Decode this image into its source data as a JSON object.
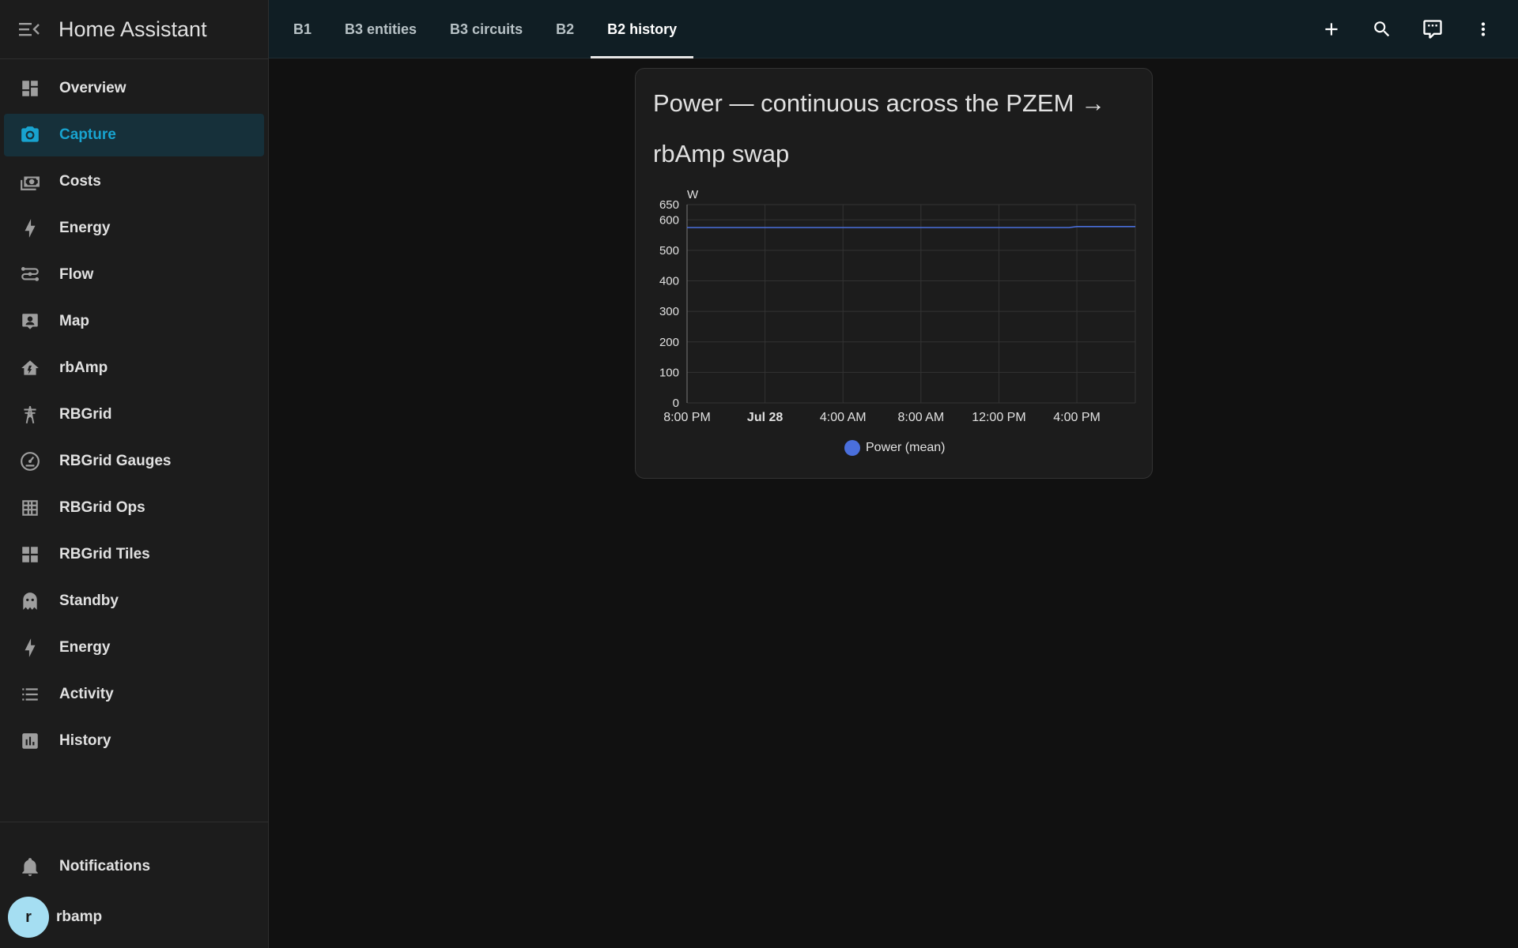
{
  "app": {
    "title": "Home Assistant"
  },
  "sidebar": {
    "items": [
      {
        "label": "Overview",
        "icon": "dashboard-icon"
      },
      {
        "label": "Capture",
        "icon": "camera-icon",
        "selected": true
      },
      {
        "label": "Costs",
        "icon": "cash-icon"
      },
      {
        "label": "Energy",
        "icon": "lightning-icon"
      },
      {
        "label": "Flow",
        "icon": "flow-icon"
      },
      {
        "label": "Map",
        "icon": "account-box-icon"
      },
      {
        "label": "rbAmp",
        "icon": "home-lightning-icon"
      },
      {
        "label": "RBGrid",
        "icon": "transmission-tower-icon"
      },
      {
        "label": "RBGrid Gauges",
        "icon": "gauge-icon"
      },
      {
        "label": "RBGrid Ops",
        "icon": "grid-icon"
      },
      {
        "label": "RBGrid Tiles",
        "icon": "view-grid-icon"
      },
      {
        "label": "Standby",
        "icon": "ghost-icon"
      },
      {
        "label": "Energy",
        "icon": "lightning-icon"
      },
      {
        "label": "Activity",
        "icon": "format-list-icon"
      },
      {
        "label": "History",
        "icon": "chart-box-icon"
      }
    ],
    "notifications_label": "Notifications",
    "user": {
      "name": "rbamp",
      "initial": "r"
    }
  },
  "topbar": {
    "tabs": [
      {
        "label": "B1"
      },
      {
        "label": "B3 entities"
      },
      {
        "label": "B3 circuits"
      },
      {
        "label": "B2"
      },
      {
        "label": "B2 history",
        "active": true
      }
    ],
    "actions": [
      "plus-icon",
      "search-icon",
      "comment-icon",
      "dots-vertical-icon"
    ]
  },
  "card": {
    "title": "Power — continuous across the PZEM → rbAmp swap"
  },
  "chart_data": {
    "type": "line",
    "unit": "W",
    "y_ticks": [
      0,
      100,
      200,
      300,
      400,
      500,
      600,
      650
    ],
    "ylim": [
      0,
      650
    ],
    "x_ticks": [
      {
        "label": "8:00 PM",
        "bold": false
      },
      {
        "label": "Jul 28",
        "bold": true
      },
      {
        "label": "4:00 AM",
        "bold": false
      },
      {
        "label": "8:00 AM",
        "bold": false
      },
      {
        "label": "12:00 PM",
        "bold": false
      },
      {
        "label": "4:00 PM",
        "bold": false
      }
    ],
    "x_range_hours": [
      0,
      23
    ],
    "series": [
      {
        "name": "Power (mean)",
        "color": "#4a6fdc",
        "points": [
          [
            0,
            575
          ],
          [
            2,
            575
          ],
          [
            4,
            575
          ],
          [
            6,
            575
          ],
          [
            8,
            575
          ],
          [
            10,
            575
          ],
          [
            12,
            575
          ],
          [
            14,
            575
          ],
          [
            16,
            575
          ],
          [
            18,
            575
          ],
          [
            19.6,
            575
          ],
          [
            20,
            578
          ],
          [
            21,
            578
          ],
          [
            22,
            578
          ],
          [
            23,
            578
          ]
        ]
      }
    ],
    "grid": true,
    "legend": "bottom-center"
  }
}
